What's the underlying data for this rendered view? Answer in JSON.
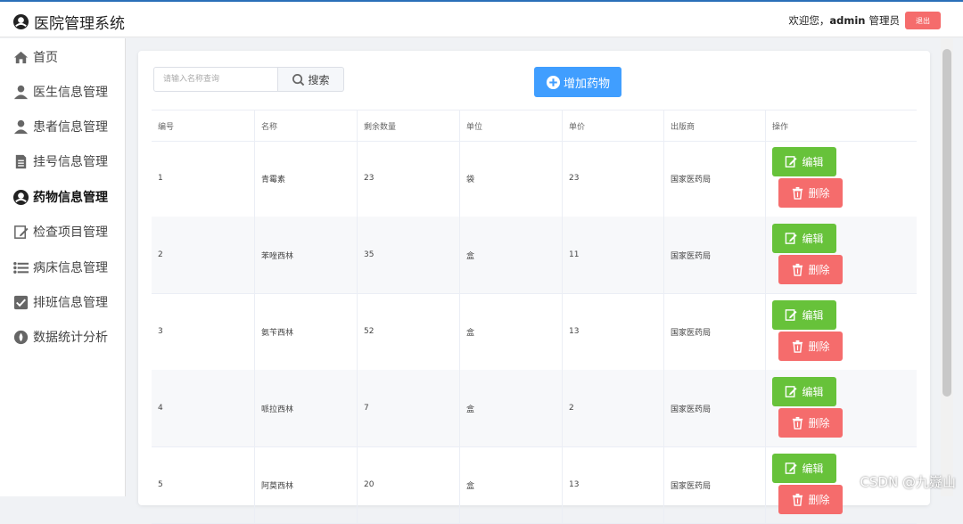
{
  "header": {
    "app_title": "医院管理系统",
    "welcome_prefix": "欢迎您，",
    "username": "admin",
    "role": "管理员",
    "logout_label": "退出"
  },
  "sidebar": {
    "items": [
      {
        "label": "首页",
        "icon": "home-icon"
      },
      {
        "label": "医生信息管理",
        "icon": "user-icon"
      },
      {
        "label": "患者信息管理",
        "icon": "user-icon"
      },
      {
        "label": "挂号信息管理",
        "icon": "document-icon"
      },
      {
        "label": "药物信息管理",
        "icon": "brand-icon",
        "active": true
      },
      {
        "label": "检查项目管理",
        "icon": "edit-icon"
      },
      {
        "label": "病床信息管理",
        "icon": "list-icon"
      },
      {
        "label": "排班信息管理",
        "icon": "checkbox-icon"
      },
      {
        "label": "数据统计分析",
        "icon": "drop-icon"
      }
    ]
  },
  "toolbar": {
    "search_placeholder": "请输入名称查询",
    "search_label": "搜索",
    "add_label": "增加药物"
  },
  "table": {
    "headers": [
      "编号",
      "名称",
      "剩余数量",
      "单位",
      "单价",
      "出版商",
      "操作"
    ],
    "edit_label": "编辑",
    "delete_label": "删除",
    "rows": [
      [
        "1",
        "青霉素",
        "23",
        "袋",
        "23",
        "国家医药局"
      ],
      [
        "2",
        "苯唑西林",
        "35",
        "盒",
        "11",
        "国家医药局"
      ],
      [
        "3",
        "氨苄西林",
        "52",
        "盒",
        "13",
        "国家医药局"
      ],
      [
        "4",
        "哌拉西林",
        "7",
        "盒",
        "2",
        "国家医药局"
      ],
      [
        "5",
        "阿莫西林",
        "20",
        "盒",
        "13",
        "国家医药局"
      ]
    ]
  },
  "watermark": "CSDN @九嶷山",
  "colors": {
    "primary": "#409eff",
    "success": "#67c23a",
    "danger": "#f56c6c"
  }
}
